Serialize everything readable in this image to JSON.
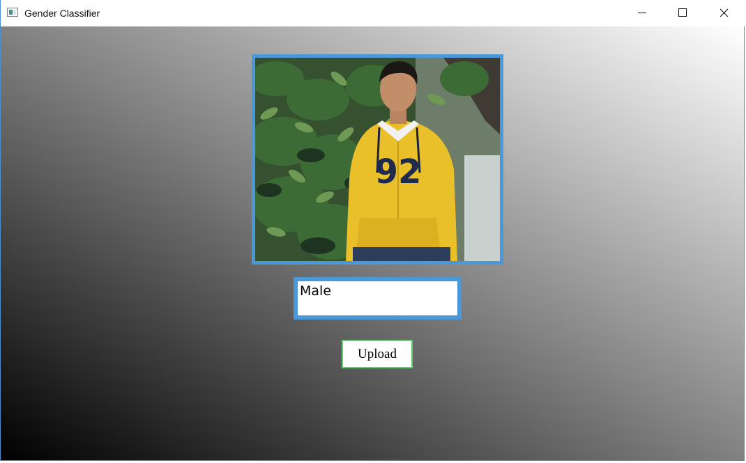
{
  "window": {
    "title": "Gender Classifier",
    "controls": [
      "minimize-icon",
      "maximize-icon",
      "close-icon"
    ]
  },
  "main": {
    "photo": {
      "description_icon": "person-photo",
      "hoodie_text": "92"
    },
    "result": {
      "label": "Male"
    },
    "upload_button": {
      "label": "Upload"
    }
  },
  "colors": {
    "frame_border": "#4a98da",
    "button_border": "#5fce6a",
    "background_dark": "#000000",
    "background_light": "#ffffff"
  }
}
